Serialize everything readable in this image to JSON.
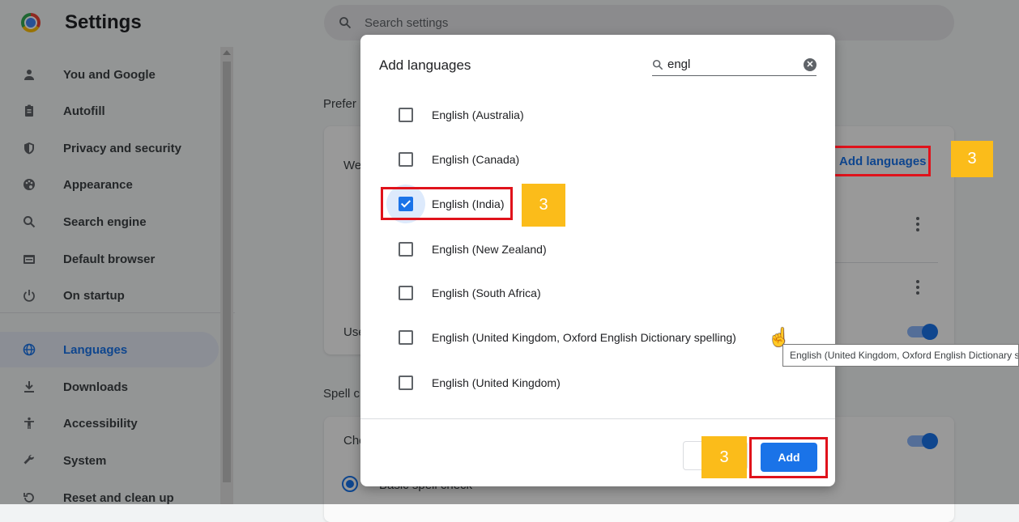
{
  "sidebar": {
    "title": "Settings",
    "items": [
      {
        "label": "You and Google",
        "icon": "person-icon"
      },
      {
        "label": "Autofill",
        "icon": "clipboard-icon"
      },
      {
        "label": "Privacy and security",
        "icon": "shield-icon"
      },
      {
        "label": "Appearance",
        "icon": "palette-icon"
      },
      {
        "label": "Search engine",
        "icon": "search-icon"
      },
      {
        "label": "Default browser",
        "icon": "browser-icon"
      },
      {
        "label": "On startup",
        "icon": "power-icon"
      },
      {
        "label": "Languages",
        "icon": "globe-icon",
        "active": true
      },
      {
        "label": "Downloads",
        "icon": "download-icon"
      },
      {
        "label": "Accessibility",
        "icon": "accessibility-icon"
      },
      {
        "label": "System",
        "icon": "wrench-icon"
      },
      {
        "label": "Reset and clean up",
        "icon": "reset-icon"
      }
    ]
  },
  "search": {
    "placeholder": "Search settings"
  },
  "background": {
    "preferred_section": "Prefer",
    "card_text_1": "We",
    "card_text_2": "Use",
    "add_languages_link": "Add languages",
    "spell_section": "Spell c",
    "spell_card_text": "Che",
    "basic_spell_check": "Basic spell check"
  },
  "dialog": {
    "title": "Add languages",
    "search_value": "engl",
    "languages": [
      {
        "label": "English (Australia)",
        "checked": false
      },
      {
        "label": "English (Canada)",
        "checked": false
      },
      {
        "label": "English (India)",
        "checked": true
      },
      {
        "label": "English (New Zealand)",
        "checked": false
      },
      {
        "label": "English (South Africa)",
        "checked": false
      },
      {
        "label": "English (United Kingdom, Oxford English Dictionary spelling)",
        "checked": false
      },
      {
        "label": "English (United Kingdom)",
        "checked": false
      }
    ],
    "cancel_label": "C",
    "add_label": "Add"
  },
  "annotations": {
    "step_number": "3"
  },
  "tooltip": {
    "text": "English (United Kingdom, Oxford English Dictionary spelling)"
  },
  "colors": {
    "accent": "#1a73e8",
    "highlight": "#e0121b",
    "badge": "#fbbc1a"
  }
}
